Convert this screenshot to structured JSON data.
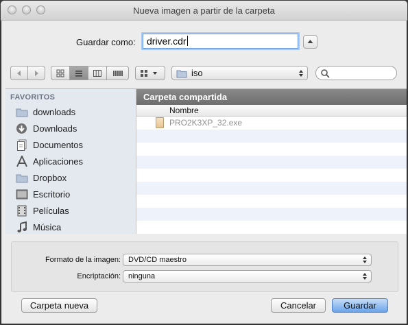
{
  "window": {
    "title": "Nueva imagen a partir de la carpeta"
  },
  "save": {
    "label": "Guardar como:",
    "value": "driver.cdr"
  },
  "toolbar": {
    "location": "iso",
    "search_placeholder": ""
  },
  "sidebar": {
    "section": "FAVORITOS",
    "items": [
      {
        "label": "downloads",
        "icon": "folder-icon"
      },
      {
        "label": "Downloads",
        "icon": "download-icon"
      },
      {
        "label": "Documentos",
        "icon": "documents-icon"
      },
      {
        "label": "Aplicaciones",
        "icon": "applications-icon"
      },
      {
        "label": "Dropbox",
        "icon": "folder-icon"
      },
      {
        "label": "Escritorio",
        "icon": "desktop-icon"
      },
      {
        "label": "Películas",
        "icon": "film-icon"
      },
      {
        "label": "Música",
        "icon": "music-icon"
      }
    ]
  },
  "content": {
    "folder_title": "Carpeta compartida",
    "column_name": "Nombre",
    "files": [
      {
        "name": "PRO2K3XP_32.exe"
      }
    ]
  },
  "options": {
    "format_label": "Formato de la imagen:",
    "format_value": "DVD/CD maestro",
    "encryption_label": "Encriptación:",
    "encryption_value": "ninguna"
  },
  "buttons": {
    "new_folder": "Carpeta nueva",
    "cancel": "Cancelar",
    "save": "Guardar"
  }
}
